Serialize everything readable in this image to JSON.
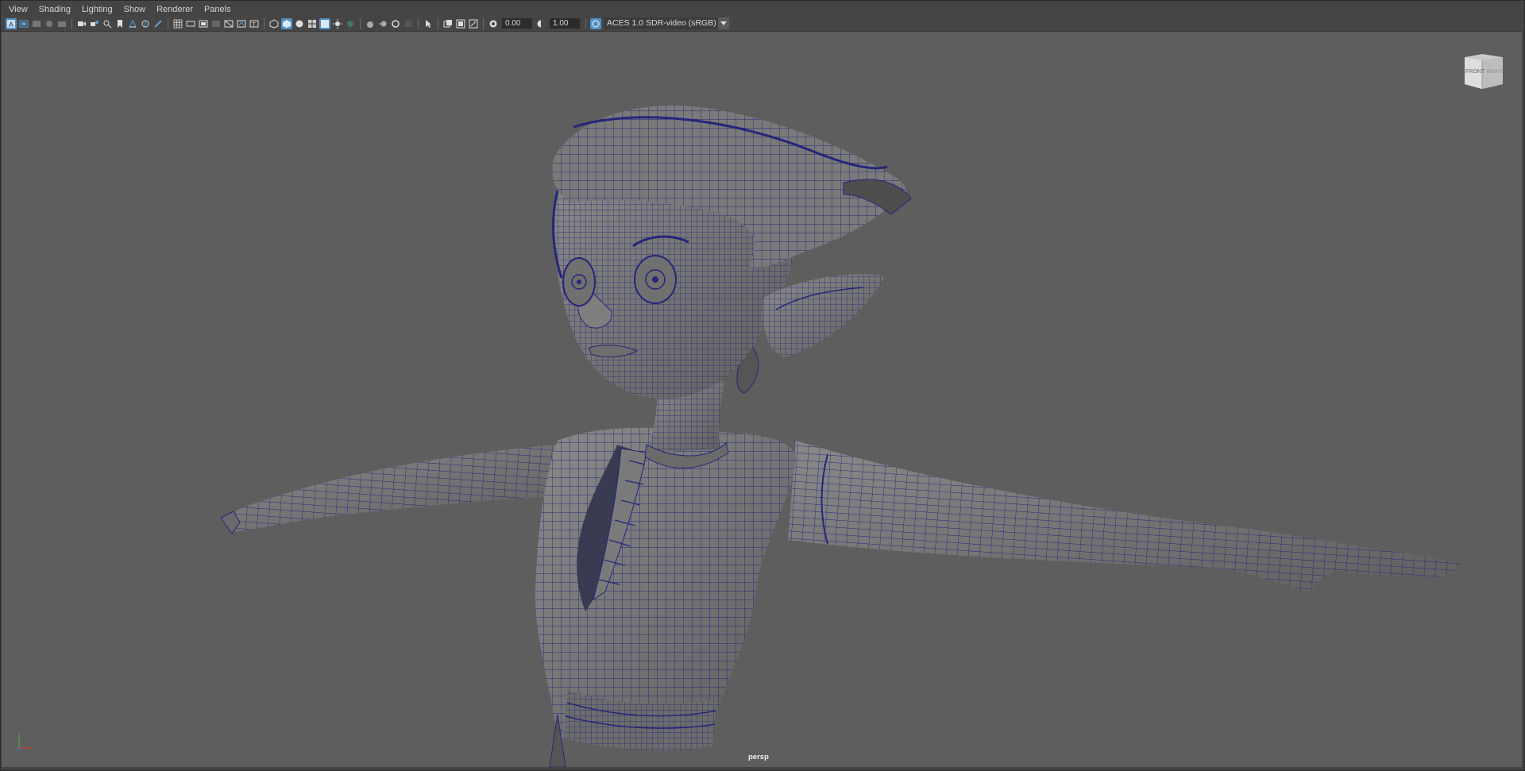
{
  "menus": [
    "View",
    "Shading",
    "Lighting",
    "Show",
    "Renderer",
    "Panels"
  ],
  "toolbar": {
    "exposure": "0.00",
    "gamma": "1.00",
    "color_management": "ACES 1.0 SDR-video (sRGB)",
    "icons": [
      "select-camera-icon",
      "camera-attributes-icon",
      "bookmarks-icon",
      "image-plane-icon",
      "2d-pan-zoom-icon",
      "grease-pencil-icon",
      "grid-icon",
      "film-gate-icon",
      "resolution-gate-icon",
      "gate-mask-icon",
      "field-chart-icon",
      "safe-action-icon",
      "safe-title-icon",
      "wireframe-icon",
      "smooth-shade-icon",
      "default-material-icon",
      "wireframe-on-shaded-icon",
      "textured-icon",
      "use-all-lights-icon",
      "shadows-icon",
      "screen-space-ao-icon",
      "motion-blur-icon",
      "multisample-aa-icon",
      "depth-of-field-icon",
      "isolate-select-icon",
      "xray-icon",
      "xray-joints-icon",
      "backface-culling-icon",
      "exposure-icon",
      "gamma-icon",
      "view-transform-icon"
    ]
  },
  "viewport": {
    "camera": "persp",
    "viewcube": {
      "front": "FRONT",
      "right": "RIGHT"
    },
    "background_color": "#5e5e5e",
    "wire_color": "#26257a",
    "mesh_color": "#777777"
  }
}
